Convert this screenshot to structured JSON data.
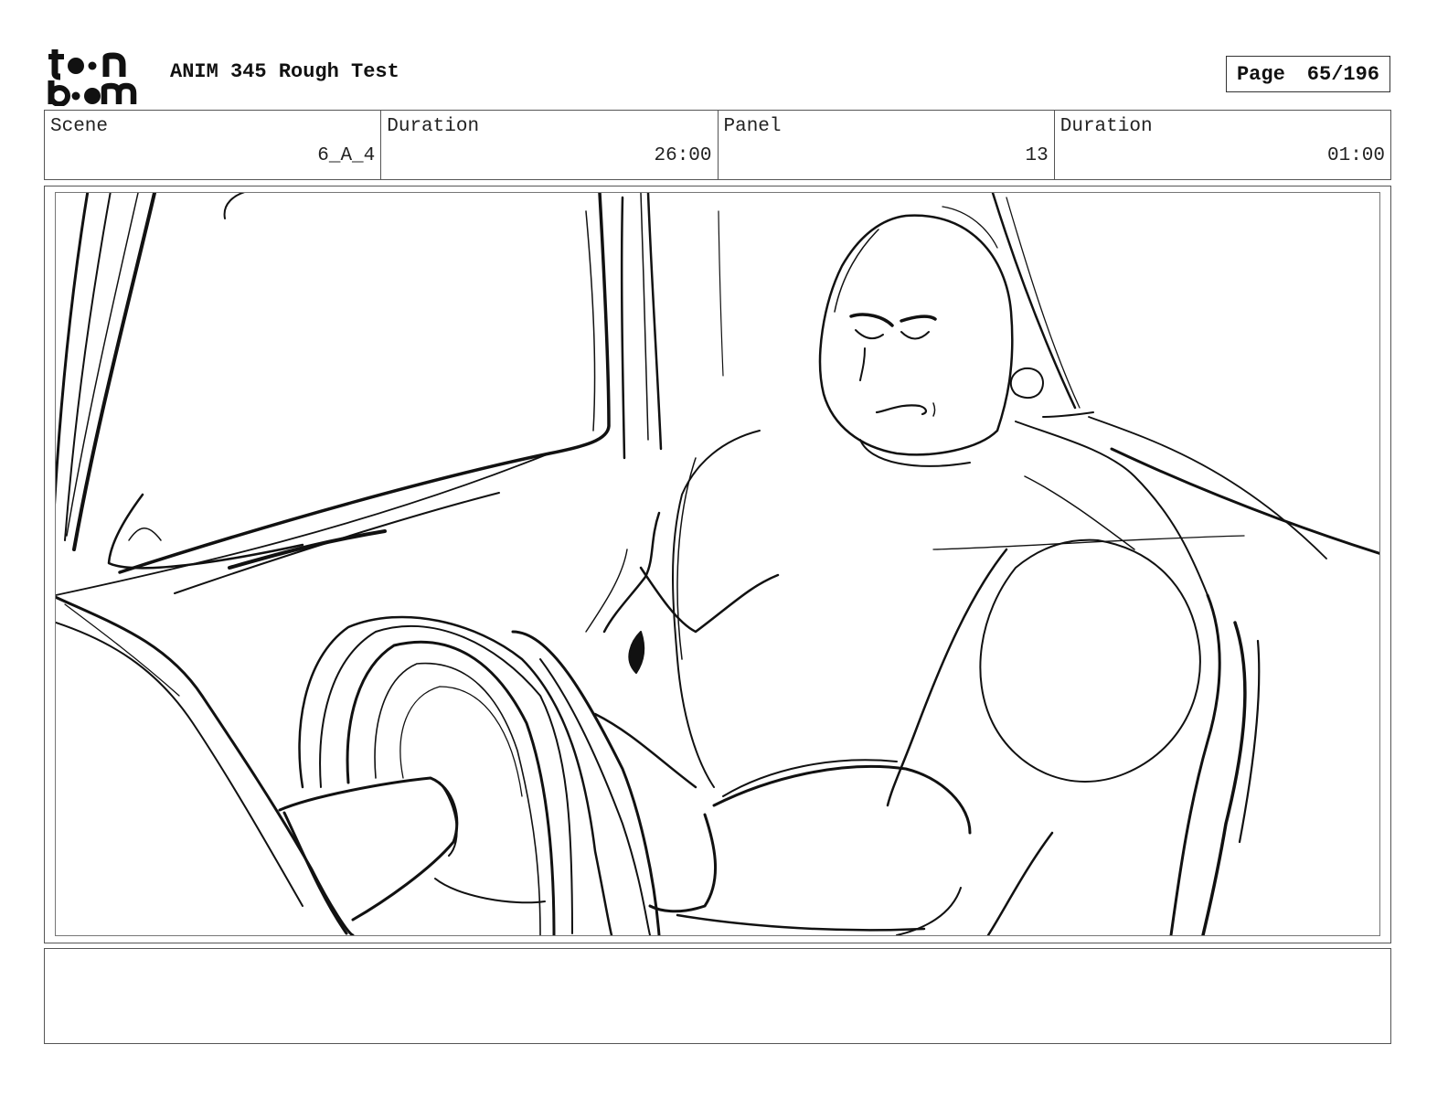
{
  "header": {
    "logo_top": "to n",
    "logo_bottom": "b m",
    "title": "ANIM 345 Rough Test",
    "page_label": "Page",
    "page_value": "65/196"
  },
  "info": {
    "scene_label": "Scene",
    "scene_value": "6_A_4",
    "duration_label": "Duration",
    "duration_value": "26:00",
    "panel_label": "Panel",
    "panel_value": "13",
    "panel_duration_label": "Duration",
    "panel_duration_value": "01:00"
  },
  "notes": {
    "text": ""
  }
}
